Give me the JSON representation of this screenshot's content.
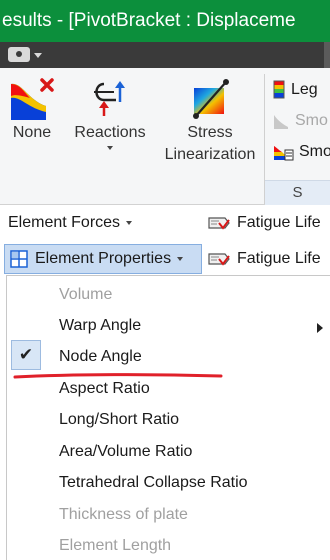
{
  "window": {
    "title": "esults - [PivotBracket : Displaceme"
  },
  "ribbon": {
    "buttons": {
      "none": "None",
      "reactions": "Reactions",
      "stress_line1": "Stress",
      "stress_line2": "Linearization"
    },
    "small_items": {
      "legend": "Leg",
      "smooth1": "Smo",
      "smooth2": "Smo"
    },
    "panel_label": "S"
  },
  "toolbar": {
    "element_forces": "Element Forces",
    "fatigue_life_1": "Fatigue Life",
    "element_properties": "Element Properties",
    "fatigue_life_2": "Fatigue Life"
  },
  "menu": {
    "items": [
      {
        "label": "Volume",
        "enabled": false
      },
      {
        "label": "Warp Angle",
        "enabled": true,
        "submenu": true
      },
      {
        "label": "Node Angle",
        "enabled": true,
        "checked": true
      },
      {
        "label": "Aspect Ratio",
        "enabled": true
      },
      {
        "label": "Long/Short Ratio",
        "enabled": true
      },
      {
        "label": "Area/Volume Ratio",
        "enabled": true
      },
      {
        "label": "Tetrahedral Collapse Ratio",
        "enabled": true
      },
      {
        "label": "Thickness of plate",
        "enabled": false
      },
      {
        "label": "Element Length",
        "enabled": false
      }
    ],
    "check_mark": "✔"
  },
  "colors": {
    "title_bar": "#0c8f3c",
    "menu_highlight": "#d8e6f6",
    "button_active": "#c9dcf3",
    "annotation_underline": "#e0202a"
  }
}
